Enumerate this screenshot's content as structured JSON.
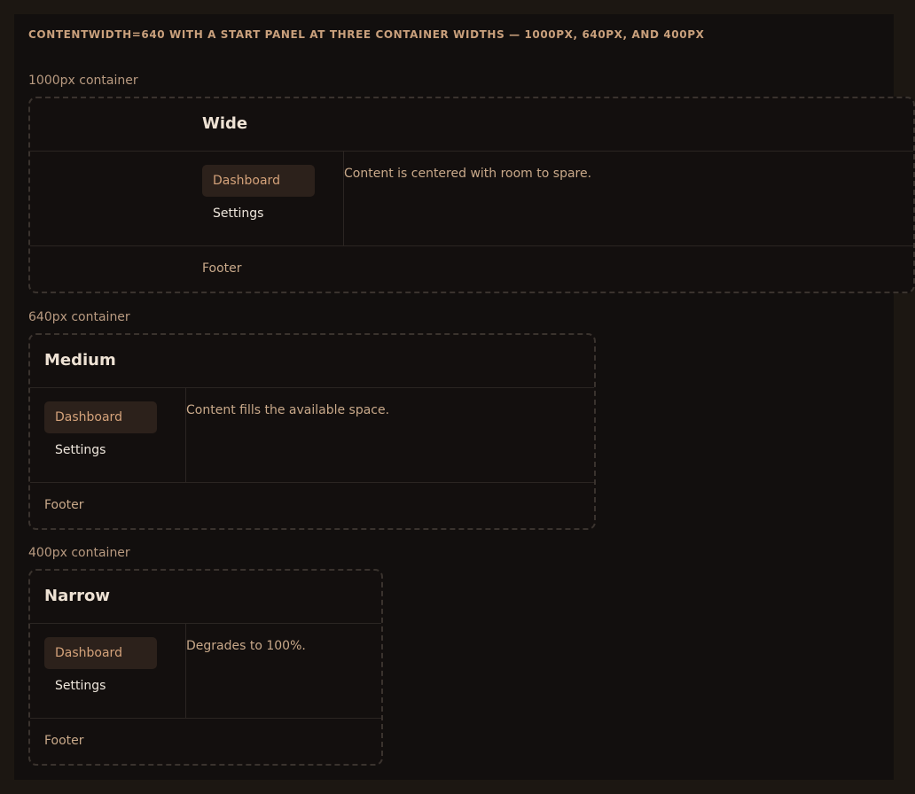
{
  "heading": "contentWidth=640 with a start panel at three container widths — 1000px, 640px, and 400px",
  "sections": [
    {
      "label": "1000px container",
      "title": "Wide",
      "nav": [
        "Dashboard",
        "Settings"
      ],
      "content": "Content is centered with room to spare.",
      "footer": "Footer"
    },
    {
      "label": "640px container",
      "title": "Medium",
      "nav": [
        "Dashboard",
        "Settings"
      ],
      "content": "Content fills the available space.",
      "footer": "Footer"
    },
    {
      "label": "400px container",
      "title": "Narrow",
      "nav": [
        "Dashboard",
        "Settings"
      ],
      "content": "Degrades to 100%.",
      "footer": "Footer"
    }
  ],
  "colors": {
    "page_bg": "#1c1712",
    "frame_bg": "#120f0e",
    "accent": "#d4a27a",
    "active_nav_bg": "#2c211b",
    "title_text": "#eee2d4",
    "border": "#3a332e"
  }
}
